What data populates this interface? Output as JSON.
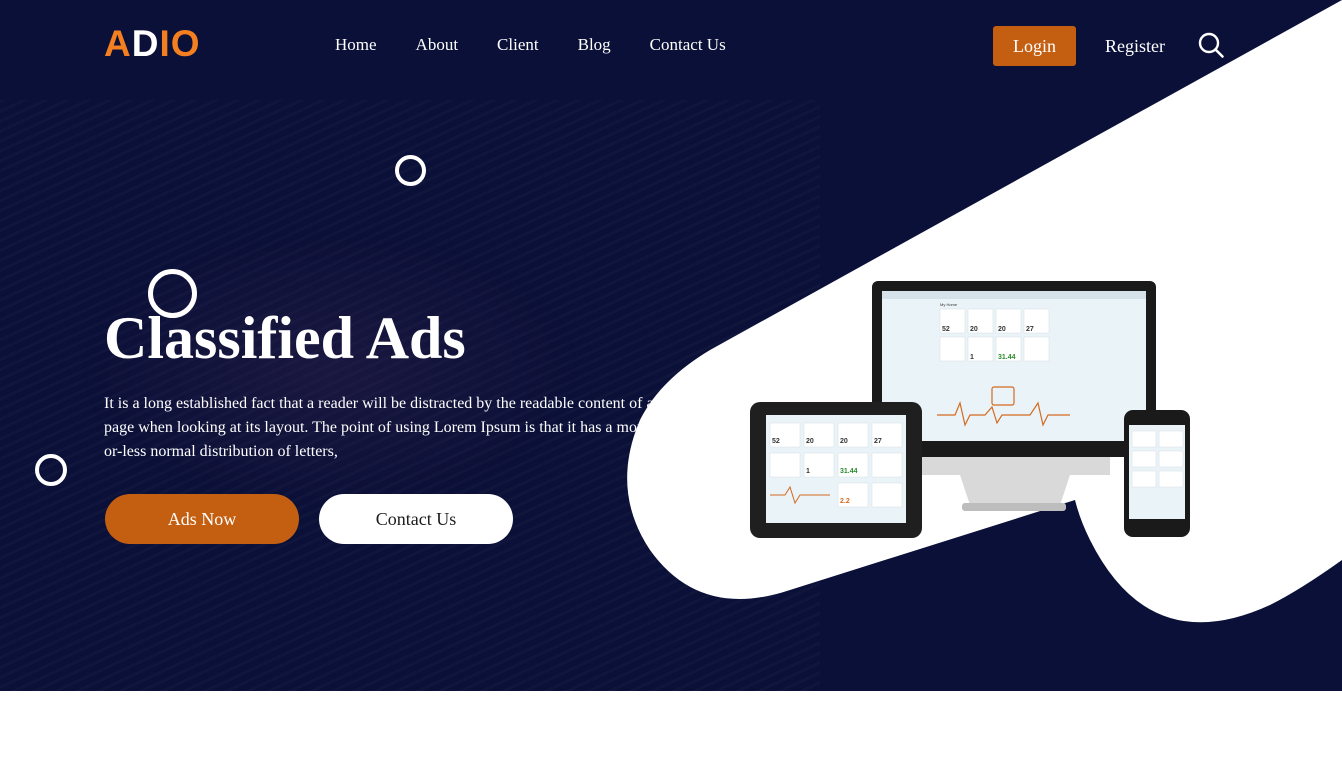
{
  "brand": {
    "logo_a": "A",
    "logo_d": "D",
    "logo_io": "IO",
    "accent": "#f47f20",
    "button_color": "#c45f12",
    "hero_bg": "#0b1038"
  },
  "nav": {
    "items": [
      {
        "label": "Home"
      },
      {
        "label": "About"
      },
      {
        "label": "Client"
      },
      {
        "label": "Blog"
      },
      {
        "label": "Contact Us"
      }
    ]
  },
  "header": {
    "login_label": "Login",
    "register_label": "Register",
    "search_icon": "search-icon"
  },
  "hero": {
    "title": "Classified Ads",
    "description": "It is a long established fact that a reader will be distracted by the readable content of a page when looking at its layout. The point of using Lorem Ipsum is that it has a more-or-less normal distribution of letters,",
    "primary_button": "Ads Now",
    "secondary_button": "Contact Us"
  },
  "dashboard": {
    "title": "My Home",
    "tiles": [
      "52",
      "20",
      "20",
      "27",
      "1",
      "20",
      "31.44"
    ],
    "tablet_values": [
      "52",
      "20",
      "20",
      "27",
      "1",
      "31.44",
      "2.2"
    ]
  }
}
